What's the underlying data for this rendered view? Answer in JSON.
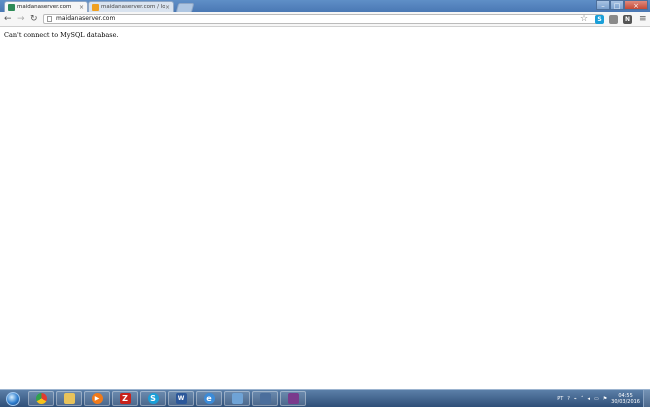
{
  "browser": {
    "tabs": [
      {
        "title": "maidanaserver.com",
        "favicon": "green-c-icon",
        "active": true
      },
      {
        "title": "maidanaserver.com / loca",
        "favicon": "phpmyadmin-warning-icon",
        "active": false
      }
    ],
    "address": "maidanaserver.com",
    "extensions": [
      {
        "name": "skype-icon",
        "letter": "S",
        "color": "#1a9fd8"
      },
      {
        "name": "extension-icon",
        "letter": "",
        "color": "#8a8a8a"
      },
      {
        "name": "evernote-n-icon",
        "letter": "N",
        "color": "#555555"
      }
    ]
  },
  "page": {
    "message": "Can't connect to MySQL database."
  },
  "taskbar": {
    "apps": [
      {
        "name": "chrome-icon",
        "glyph": "",
        "color": "#e33b2e"
      },
      {
        "name": "explorer-folder-icon",
        "glyph": "",
        "color": "#e8c35a"
      },
      {
        "name": "media-player-icon",
        "glyph": "▶",
        "color": "#f07a1a"
      },
      {
        "name": "filezilla-icon",
        "glyph": "Z",
        "color": "#c8221c"
      },
      {
        "name": "skype-icon",
        "glyph": "S",
        "color": "#1a9fd8"
      },
      {
        "name": "word-icon",
        "glyph": "W",
        "color": "#2b579a"
      },
      {
        "name": "ie-icon",
        "glyph": "e",
        "color": "#3b8bd8"
      },
      {
        "name": "window-icon",
        "glyph": "",
        "color": "#6fa3d6"
      },
      {
        "name": "network-tool-icon",
        "glyph": "",
        "color": "#4b6e9c"
      },
      {
        "name": "winrar-icon",
        "glyph": "",
        "color": "#7a3b8c"
      }
    ],
    "tray": {
      "language": "PT",
      "time": "04:55",
      "date": "30/03/2016"
    }
  }
}
